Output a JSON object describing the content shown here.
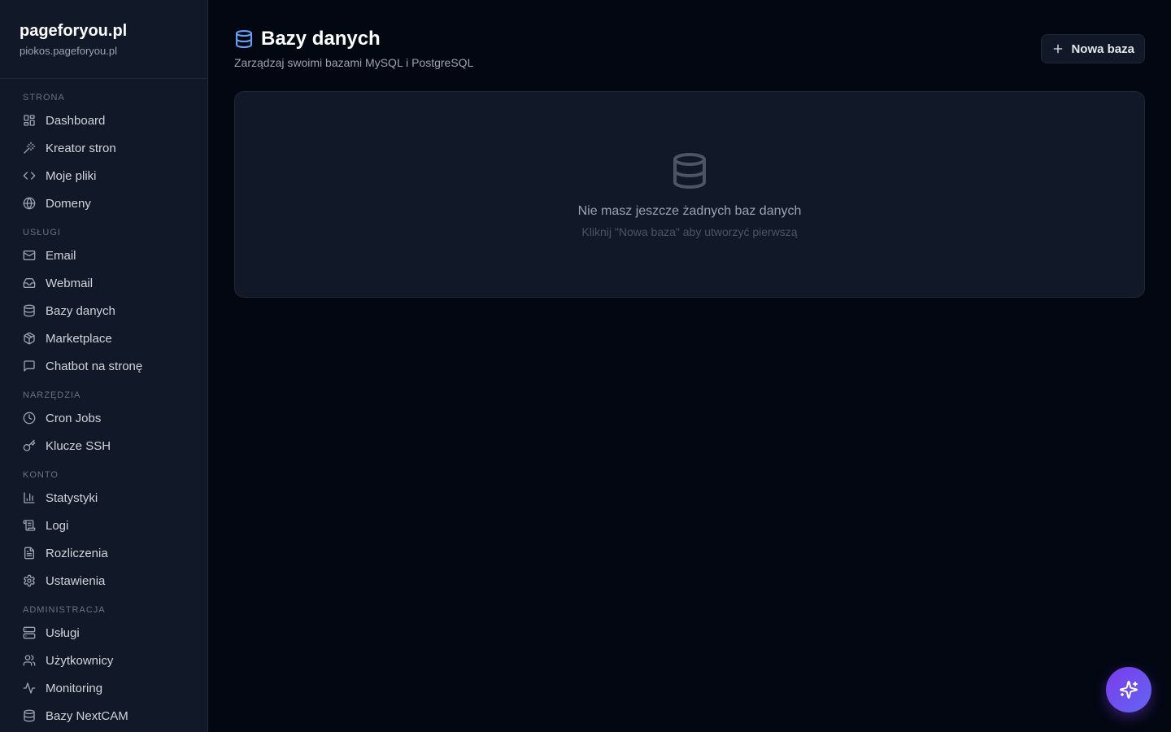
{
  "brand": {
    "title": "pageforyou.pl",
    "subtitle": "piokos.pageforyou.pl"
  },
  "sidebar": {
    "sections": [
      {
        "header": "STRONA",
        "items": [
          "Dashboard",
          "Kreator stron",
          "Moje pliki",
          "Domeny"
        ]
      },
      {
        "header": "USŁUGI",
        "items": [
          "Email",
          "Webmail",
          "Bazy danych",
          "Marketplace",
          "Chatbot na stronę"
        ]
      },
      {
        "header": "NARZĘDZIA",
        "items": [
          "Cron Jobs",
          "Klucze SSH"
        ]
      },
      {
        "header": "KONTO",
        "items": [
          "Statystyki",
          "Logi",
          "Rozliczenia",
          "Ustawienia"
        ]
      },
      {
        "header": "ADMINISTRACJA",
        "items": [
          "Usługi",
          "Użytkownicy",
          "Monitoring",
          "Bazy NextCAM"
        ]
      }
    ],
    "icons": {
      "Dashboard": "layout-grid-icon",
      "Kreator stron": "magic-wand-icon",
      "Moje pliki": "code-icon",
      "Domeny": "globe-icon",
      "Email": "mail-icon",
      "Webmail": "inbox-icon",
      "Bazy danych": "database-icon",
      "Marketplace": "package-icon",
      "Chatbot na stronę": "message-square-icon",
      "Cron Jobs": "clock-icon",
      "Klucze SSH": "key-icon",
      "Statystyki": "bar-chart-icon",
      "Logi": "scroll-icon",
      "Rozliczenia": "file-text-icon",
      "Ustawienia": "gear-icon",
      "Usługi": "server-icon",
      "Użytkownicy": "users-icon",
      "Monitoring": "activity-icon",
      "Bazy NextCAM": "database-icon"
    }
  },
  "page": {
    "title": "Bazy danych",
    "subtitle": "Zarządzaj swoimi bazami MySQL i PostgreSQL",
    "new_button": "Nowa baza"
  },
  "empty_state": {
    "title": "Nie masz jeszcze żadnych baz danych",
    "subtitle": "Kliknij \"Nowa baza\" aby utworzyć pierwszą"
  },
  "colors": {
    "accent": "#60a5fa",
    "fab_start": "#7c3aed",
    "fab_end": "#6366f1",
    "background": "#030712",
    "sidebar": "#111827"
  }
}
